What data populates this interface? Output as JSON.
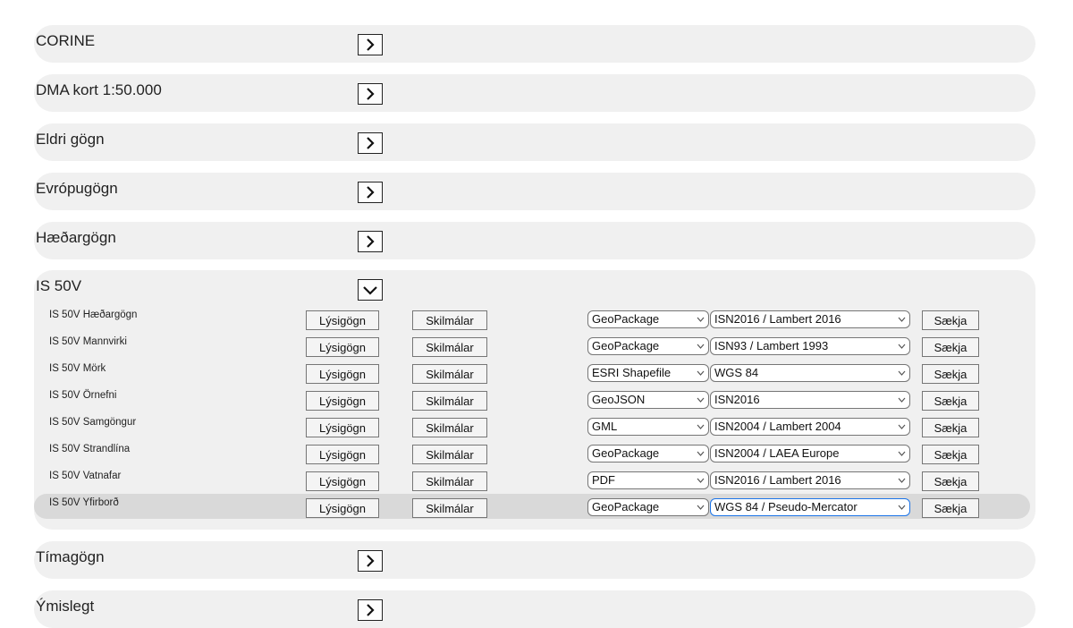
{
  "categories": [
    {
      "title": "CORINE"
    },
    {
      "title": "DMA kort 1:50.000"
    },
    {
      "title": "Eldri gögn"
    },
    {
      "title": "Evrópugögn"
    },
    {
      "title": "Hæðargögn"
    },
    {
      "title": "IS 50V"
    },
    {
      "title": "Tímagögn"
    },
    {
      "title": "Ýmislegt"
    }
  ],
  "buttons": {
    "metadata_label": "Lýsigögn",
    "terms_label": "Skilmálar",
    "fetch_label": "Sækja"
  },
  "is50v_rows": [
    {
      "name": "IS 50V Hæðargögn",
      "format": "GeoPackage",
      "crs": "ISN2016 / Lambert 2016"
    },
    {
      "name": "IS 50V Mannvirki",
      "format": "GeoPackage",
      "crs": "ISN93 / Lambert 1993"
    },
    {
      "name": "IS 50V Mörk",
      "format": "ESRI Shapefile",
      "crs": "WGS 84"
    },
    {
      "name": "IS 50V Örnefni",
      "format": "GeoJSON",
      "crs": "ISN2016"
    },
    {
      "name": "IS 50V Samgöngur",
      "format": "GML",
      "crs": "ISN2004 / Lambert 2004"
    },
    {
      "name": "IS 50V Strandlína",
      "format": "GeoPackage",
      "crs": "ISN2004 / LAEA Europe"
    },
    {
      "name": "IS 50V Vatnafar",
      "format": "PDF",
      "crs": "ISN2016 / Lambert 2016"
    },
    {
      "name": "IS 50V Yfirborð",
      "format": "GeoPackage",
      "crs": "WGS 84 / Pseudo-Mercator"
    }
  ],
  "colors": {
    "panel_bg": "#f0f0f0",
    "row_highlight": "#d9d9d9",
    "focus_border": "#1a73e8"
  }
}
